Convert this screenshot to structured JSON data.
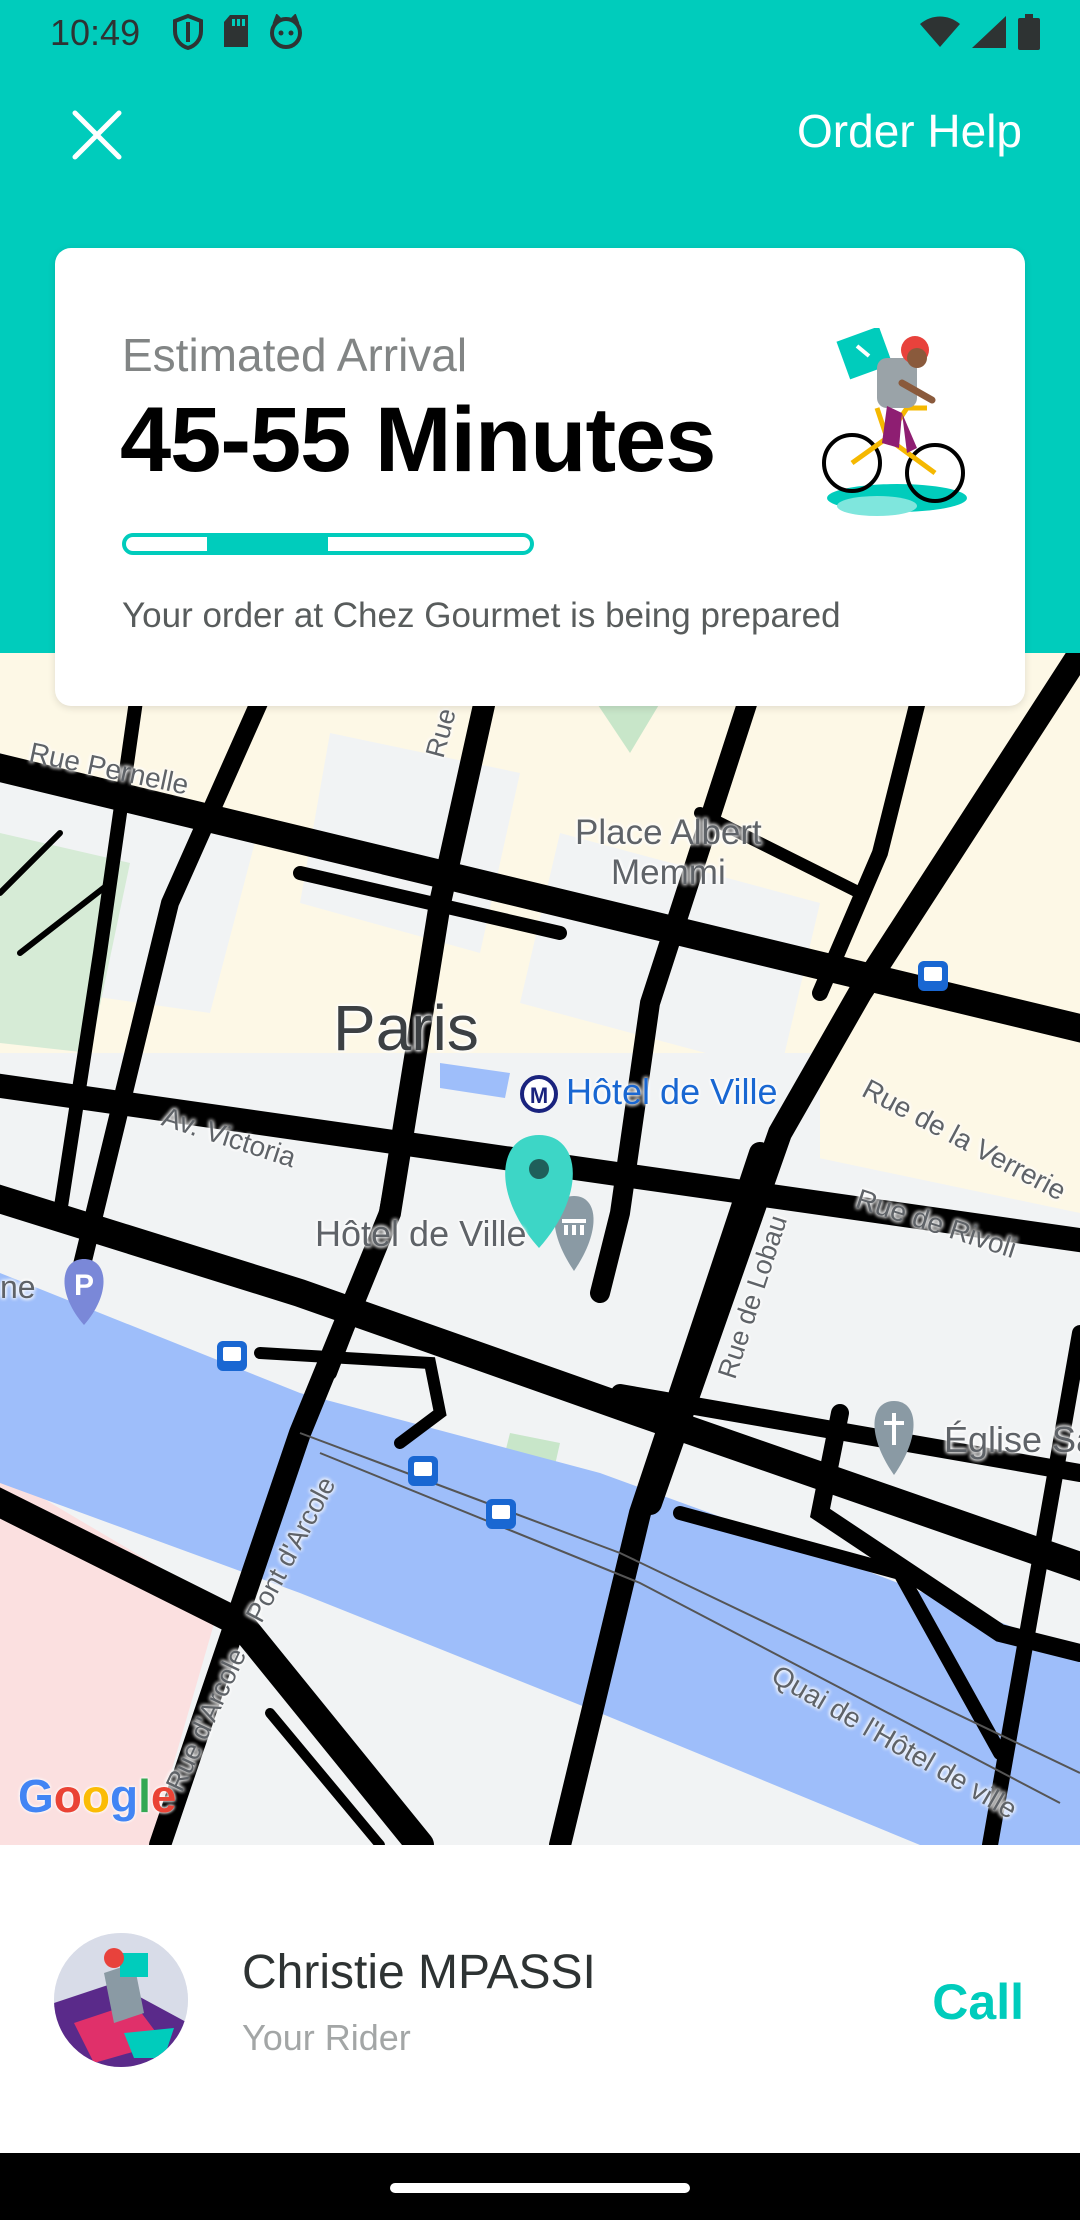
{
  "status_bar": {
    "time": "10:49",
    "left_icons": [
      "shield-icon",
      "sd-card-icon",
      "cat-face-icon"
    ],
    "right_icons": [
      "wifi-icon",
      "signal-icon",
      "battery-icon"
    ]
  },
  "header": {
    "close_icon": "close-icon",
    "help_label": "Order Help"
  },
  "eta_card": {
    "label": "Estimated Arrival",
    "value": "45-55 Minutes",
    "progress_segment": {
      "start": 0.2,
      "end": 0.5
    },
    "message": "Your order at Chez Gourmet is being prepared",
    "illustration": "rider-on-bicycle-illustration"
  },
  "map": {
    "labels": {
      "rue_pernelle": "Rue Pernelle",
      "rue_du_renard": "Rue du Renard",
      "place_albert": "Place Albert\nMemmi",
      "paris": "Paris",
      "metro_station": "Hôtel de Ville",
      "rue_verrerie": "Rue de la Verrerie",
      "av_victoria": "Av. Victoria",
      "rue_rivoli": "Rue de Rivoli",
      "hotel_de_ville": "Hôtel de Ville",
      "rue_lobau": "Rue de Lobau",
      "eglise": "Église Sa",
      "pont_arcole": "Pont d'Arcole",
      "rue_arcole": "Rue d'Arcole",
      "quai": "Quai de l'Hôtel de ville",
      "edge_label": "ne"
    },
    "google_logo": "Google",
    "marker_icon": "map-pin-icon",
    "colors": {
      "road": "#000000",
      "water": "#9ebefa",
      "park": "#d6ebd6",
      "block": "#f1f3f4",
      "pedestrian": "#fdf8e6",
      "accent": "#00ccbc"
    }
  },
  "rider": {
    "name": "Christie MPASSI",
    "role": "Your Rider",
    "call_label": "Call",
    "avatar": "rider-avatar"
  },
  "colors": {
    "brand": "#00ccbc",
    "text_dark": "#2e3333",
    "text_muted": "#828585"
  }
}
